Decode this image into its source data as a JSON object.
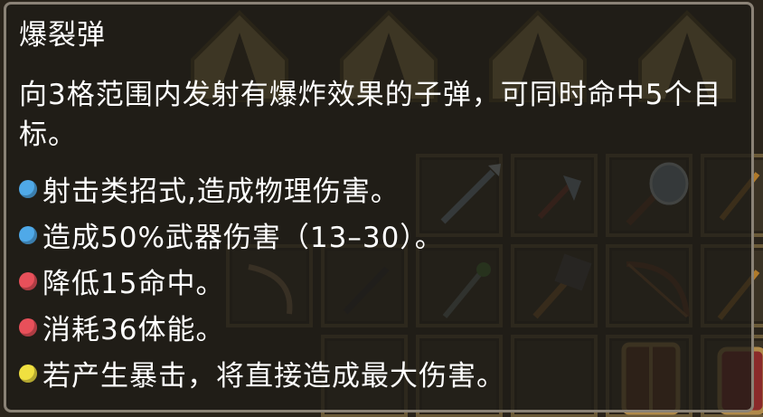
{
  "tooltip": {
    "title": "爆裂弹",
    "description": "向3格范围内发射有爆炸效果的子弹，可同时命中5个目标。",
    "effects": [
      {
        "text": "射击类招式,造成物理伤害。",
        "bullet_color": "#4fa9e8",
        "bullet_icon": "blue-dot-icon"
      },
      {
        "text": "造成50%武器伤害（13–30）。",
        "bullet_color": "#4fa9e8",
        "bullet_icon": "blue-dot-icon"
      },
      {
        "text": "降低15命中。",
        "bullet_color": "#e8505a",
        "bullet_icon": "red-dot-icon"
      },
      {
        "text": "消耗36体能。",
        "bullet_color": "#e8505a",
        "bullet_icon": "red-dot-icon"
      },
      {
        "text": "若产生暴击，将直接造成最大伤害。",
        "bullet_color": "#f0e040",
        "bullet_icon": "yellow-dot-icon"
      }
    ]
  },
  "background": {
    "tents": [
      "tent-icon",
      "tent-icon",
      "tent-icon",
      "tent-icon",
      "tent-icon"
    ],
    "items": [
      "spear-icon",
      "axe-icon",
      "battle-axe-icon",
      "sword-icon",
      "bow-icon",
      "staff-icon",
      "mace-icon",
      "crossbow-icon",
      "shield-icon"
    ]
  }
}
